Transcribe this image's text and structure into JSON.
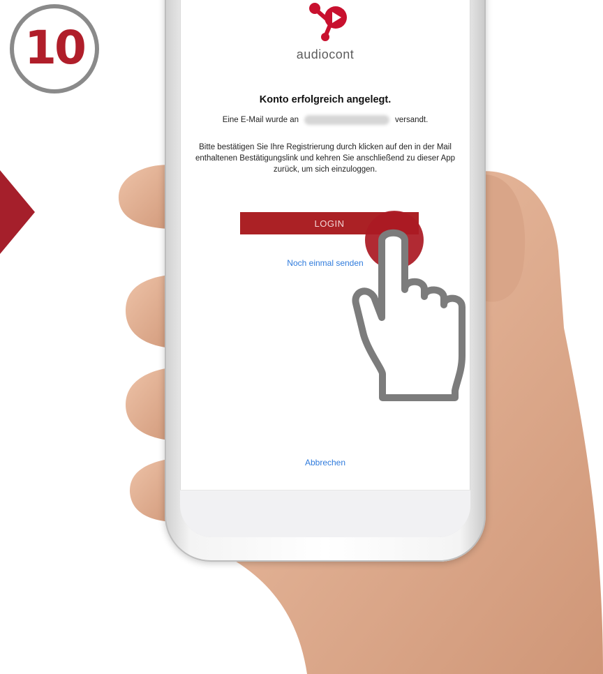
{
  "step": {
    "number": "10"
  },
  "app": {
    "brand": "audiocont",
    "title": "Konto erfolgreich angelegt.",
    "email_prefix": "Eine E-Mail wurde an",
    "email_suffix": "versandt.",
    "instructions": "Bitte bestätigen Sie Ihre Registrierung durch klicken auf den in der Mail enthaltenen Bestätigungslink und kehren Sie anschließend zu dieser App zurück, um sich einzuloggen.",
    "login_label": "LOGIN",
    "resend_label": "Noch einmal senden",
    "cancel_label": "Abbrechen"
  },
  "icons": {
    "logo": "audiocont-logo-icon",
    "arrow": "arrow-right-icon",
    "pointer": "pointing-hand-icon"
  },
  "colors": {
    "accent": "#ab2125",
    "badge_number": "#b01e2a",
    "badge_ring": "#8a8a8a",
    "link": "#2f7bdc",
    "skin": "#e2b297"
  }
}
